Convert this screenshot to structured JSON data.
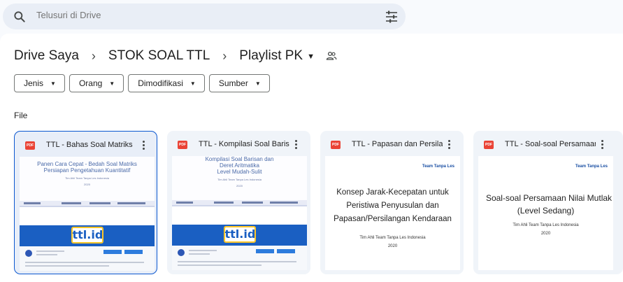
{
  "search": {
    "placeholder": "Telusuri di Drive"
  },
  "breadcrumb": {
    "root": "Drive Saya",
    "parent": "STOK SOAL TTL",
    "current": "Playlist PK"
  },
  "filters": [
    "Jenis",
    "Orang",
    "Dimodifikasi",
    "Sumber"
  ],
  "section_label": "File",
  "files": [
    {
      "title": "TTL - Bahas Soal Matriks",
      "badge": "PDF",
      "thumb_lines": [
        "Panen Cara Cepat - Bedah Soal Matriks",
        "Persiapan Pengetahuan Kuantitatif",
        "Tim Ahli Team Tanpa Les Indonesia",
        "2020"
      ],
      "logo": "ttl.id"
    },
    {
      "title": "TTL - Kompilasi Soal Barisan",
      "badge": "PDF",
      "thumb_lines": [
        "Kompilasi Soal Barisan dan",
        "Deret Aritmatika",
        "Level Mudah-Sulit",
        "Tim Ahli Team Tanpa Les Indonesia",
        "2020"
      ],
      "logo": "ttl.id"
    },
    {
      "title": "TTL - Papasan dan Persilangan",
      "badge": "PDF",
      "brand": "Team Tanpa Les",
      "big_lines": [
        "Konsep Jarak-Kecepatan untuk",
        "Peristiwa Penyusulan dan",
        "Papasan/Persilangan Kendaraan"
      ],
      "author": "Tim Ahli Team Tanpa Les Indonesia",
      "year": "2020"
    },
    {
      "title": "TTL - Soal-soal Persamaan",
      "badge": "PDF",
      "brand": "Team Tanpa Les",
      "big_lines": [
        "Soal-soal Persamaan Nilai Mutlak",
        "(Level Sedang)"
      ],
      "author": "Tim Ahli Team Tanpa Les Indonesia",
      "year": "2020"
    }
  ],
  "colors": {
    "accent": "#0b57d0",
    "pdf_red": "#ea4335",
    "search_bg": "#e9eef6",
    "ttl_blue": "#1a5fc2"
  }
}
